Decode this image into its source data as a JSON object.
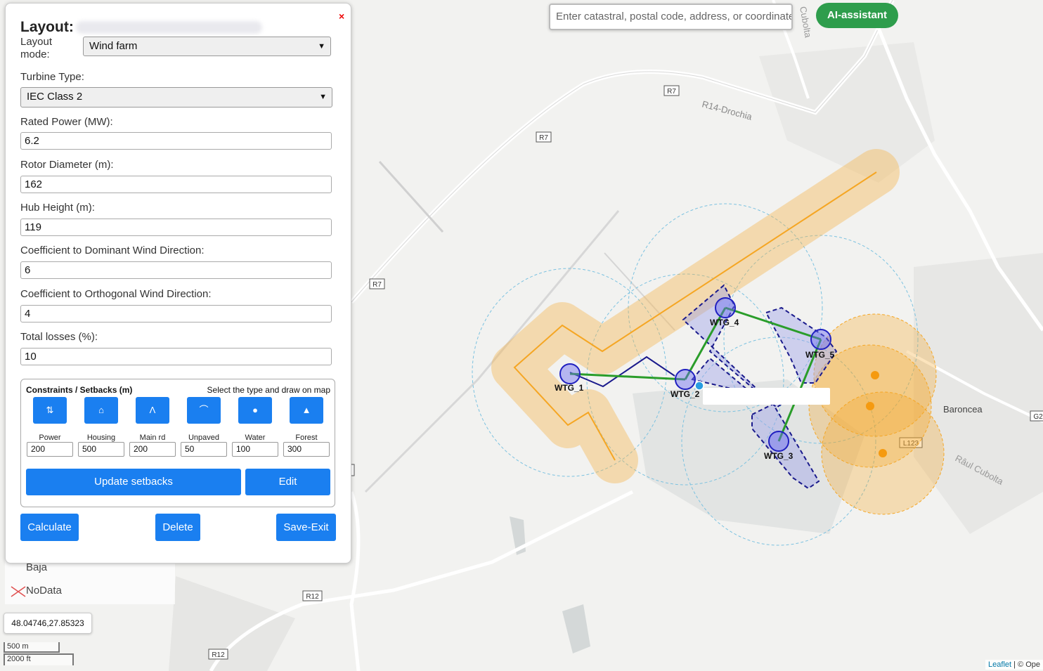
{
  "search": {
    "placeholder": "Enter catastral, postal code, address, or coordinates"
  },
  "ai_button": "AI-assistant",
  "panel": {
    "title": "Layout:",
    "close": "×",
    "layout_mode_label": "Layout mode:",
    "layout_mode_value": "Wind farm",
    "turbine_type_label": "Turbine Type:",
    "turbine_type_value": "IEC Class 2",
    "fields": [
      {
        "label": "Rated Power (MW):",
        "value": "6.2"
      },
      {
        "label": "Rotor Diameter (m):",
        "value": "162"
      },
      {
        "label": "Hub Height (m):",
        "value": "119"
      },
      {
        "label": "Coefficient to Dominant Wind Direction:",
        "value": "6"
      },
      {
        "label": "Coefficient to Orthogonal Wind Direction:",
        "value": "4"
      },
      {
        "label": "Total losses (%):",
        "value": "10"
      }
    ],
    "constraints": {
      "title": "Constraints / Setbacks (m)",
      "hint": "Select the type and draw on map",
      "items": [
        {
          "label": "Power",
          "value": "200",
          "icon": "power-tower-icon"
        },
        {
          "label": "Housing",
          "value": "500",
          "icon": "house-icon"
        },
        {
          "label": "Main rd",
          "value": "200",
          "icon": "main-road-icon"
        },
        {
          "label": "Unpaved",
          "value": "50",
          "icon": "unpaved-road-icon"
        },
        {
          "label": "Water",
          "value": "100",
          "icon": "water-drop-icon"
        },
        {
          "label": "Forest",
          "value": "300",
          "icon": "tree-icon"
        }
      ],
      "update_button": "Update setbacks",
      "edit_button": "Edit"
    },
    "calculate_button": "Calculate",
    "delete_button": "Delete",
    "save_exit_button": "Save-Exit"
  },
  "legend": {
    "baja": "Baja",
    "nodata": "NoData"
  },
  "coordinates": "48.04746,27.85323",
  "scale": {
    "metric": "500 m",
    "imperial": "2000 ft"
  },
  "attribution": {
    "leaflet": "Leaflet",
    "rest": "| © Ope"
  },
  "map_labels": {
    "road_r7": "R7",
    "road_r12": "R12",
    "road_l123": "L123",
    "road_g2": "G2",
    "r14_drochia": "R14-Drochia",
    "cubolta_top": "Cubolta",
    "raul_cubolta": "Râul Cubolta",
    "baroncea": "Baroncea"
  },
  "turbines": [
    {
      "label": "WTG_1"
    },
    {
      "label": "WTG_2"
    },
    {
      "label": "WTG_3"
    },
    {
      "label": "WTG_4"
    },
    {
      "label": "WTG_5"
    }
  ],
  "colors": {
    "accent_blue": "#1a7ff0",
    "ai_green": "#2e9d4c",
    "setback_orange": "#f5a623",
    "cable_green": "#2a9d2a",
    "area_navy": "#1a1a8c"
  }
}
